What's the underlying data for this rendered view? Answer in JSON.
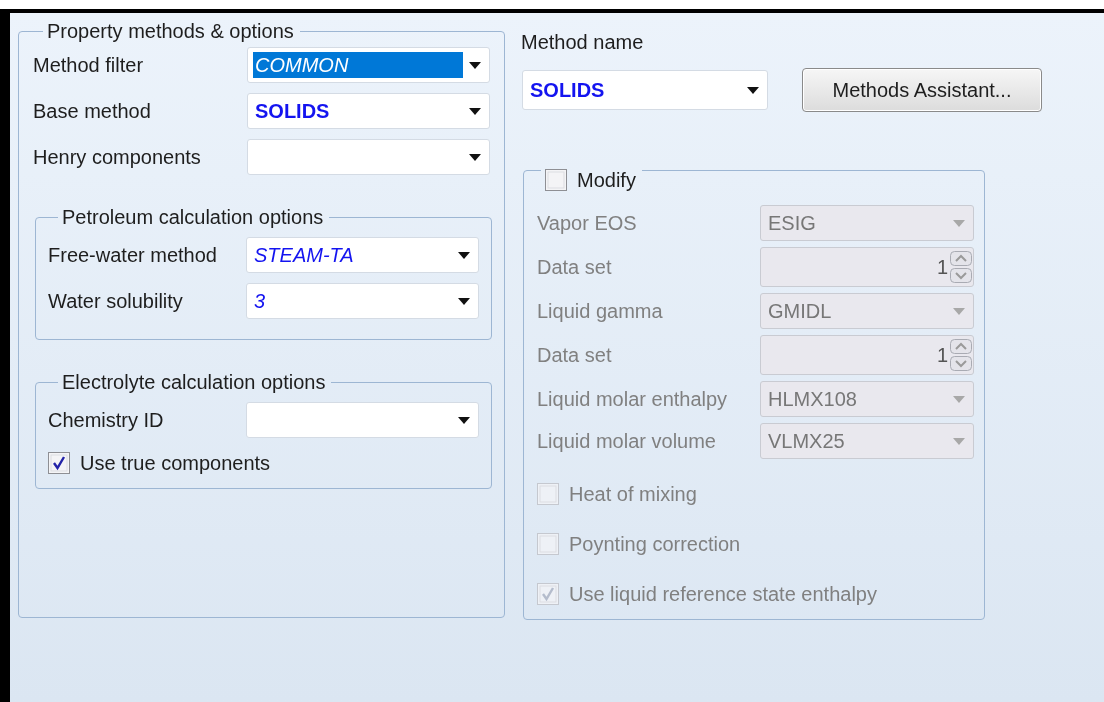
{
  "property_methods": {
    "title": "Property methods & options",
    "fields": [
      {
        "label": "Method filter",
        "value": "COMMON",
        "italic": true,
        "selected": true
      },
      {
        "label": "Base method",
        "value": "SOLIDS",
        "bold": true,
        "selected": false
      },
      {
        "label": "Henry components",
        "selected": false
      }
    ],
    "groups": [
      {
        "title": "Petroleum calculation options",
        "fields": [
          {
            "label": "Free-water method",
            "value": "STEAM-TA",
            "italic": true,
            "selected": false
          },
          {
            "label": "Water solubility",
            "value": "3",
            "italic": true,
            "selected": false
          }
        ]
      },
      {
        "title": "Electrolyte calculation options",
        "fields": [
          {
            "label": "Chemistry ID",
            "selected": false
          }
        ],
        "checkboxes": [
          {
            "label": "Use true components",
            "checked": true
          }
        ]
      }
    ]
  },
  "method_name": {
    "label": "Method name",
    "value": "SOLIDS",
    "bold": true
  },
  "buttons": [
    "Methods Assistant..."
  ],
  "modify": {
    "label": "Modify",
    "checked": false,
    "disabled": true,
    "fields": [
      {
        "kind": "combo",
        "label": "Vapor EOS",
        "value": "ESIG"
      },
      {
        "kind": "spin",
        "label": "Data set",
        "value": "1"
      },
      {
        "kind": "combo",
        "label": "Liquid gamma",
        "value": "GMIDL"
      },
      {
        "kind": "spin",
        "label": "Data set",
        "value": "1"
      },
      {
        "kind": "combo",
        "label": "Liquid molar enthalpy",
        "value": "HLMX108"
      },
      {
        "kind": "combo",
        "label": "Liquid molar volume",
        "value": "VLMX25"
      }
    ],
    "checkboxes": [
      {
        "label": "Heat of mixing",
        "checked": false
      },
      {
        "label": "Poynting correction",
        "checked": false
      },
      {
        "label": "Use liquid reference state enthalpy",
        "checked": true
      }
    ]
  }
}
